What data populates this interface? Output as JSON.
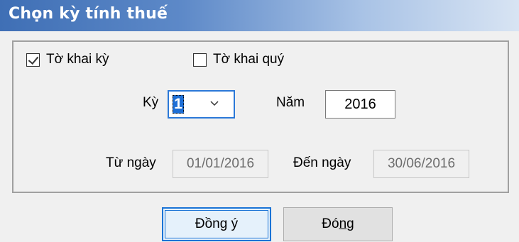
{
  "dialog": {
    "title": "Chọn kỳ tính thuế"
  },
  "options": {
    "period_return": {
      "label": "Tờ khai kỳ",
      "checked": true
    },
    "quarter_return": {
      "label": "Tờ khai quý",
      "checked": false
    }
  },
  "period": {
    "label": "Kỳ",
    "value": "1"
  },
  "year": {
    "label": "Năm",
    "value": "2016"
  },
  "date_from": {
    "label": "Từ ngày",
    "value": "01/01/2016"
  },
  "date_to": {
    "label": "Đến ngày",
    "value": "30/06/2016"
  },
  "buttons": {
    "ok_pre": "Đồn",
    "ok_underline": "g",
    "ok_post": " ý",
    "close_pre": "Đó",
    "close_underline": "n",
    "close_post": "g"
  }
}
